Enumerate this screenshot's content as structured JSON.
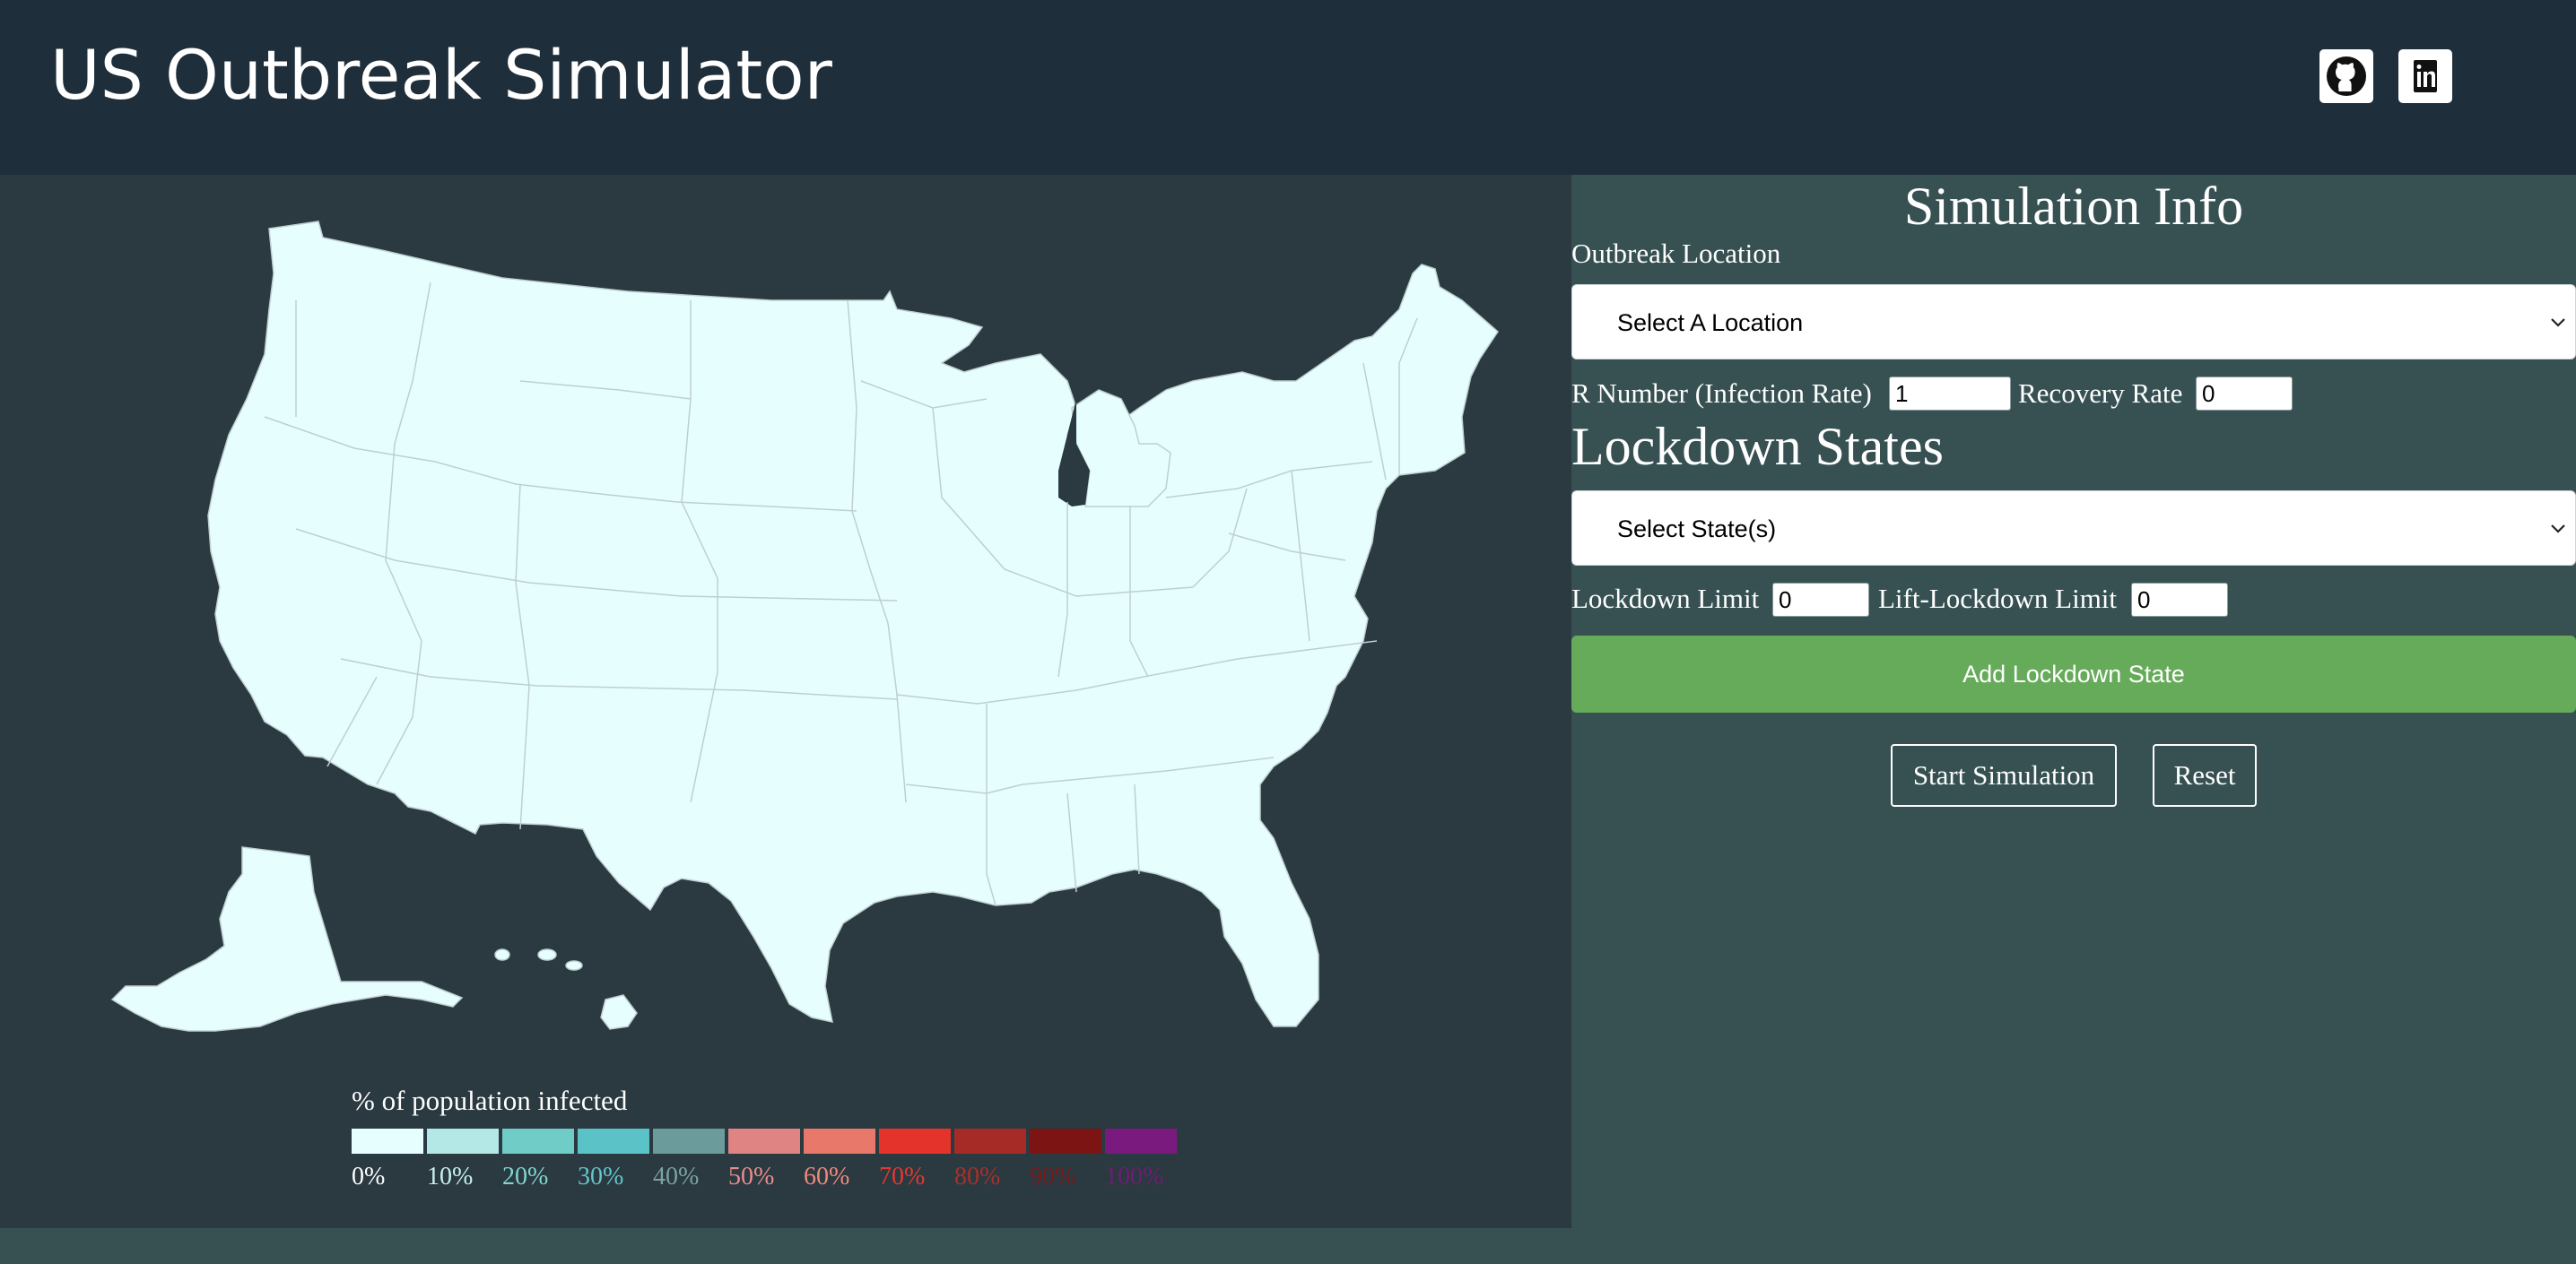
{
  "header": {
    "title": "US Outbreak Simulator",
    "icons": [
      "github-icon",
      "linkedin-icon"
    ]
  },
  "map": {
    "state_fill": "#e6fffe",
    "background": "#2b3941"
  },
  "legend": {
    "title": "% of population infected",
    "items": [
      {
        "label": "0%",
        "color": "#e6fffe",
        "text_color": "#ffffff"
      },
      {
        "label": "10%",
        "color": "#b4e8e6",
        "text_color": "#c8f0ee"
      },
      {
        "label": "20%",
        "color": "#70ccc7",
        "text_color": "#7fd6d0"
      },
      {
        "label": "30%",
        "color": "#5bc3c8",
        "text_color": "#62c6cb"
      },
      {
        "label": "40%",
        "color": "#6b9b9b",
        "text_color": "#7aa3a3"
      },
      {
        "label": "50%",
        "color": "#e08383",
        "text_color": "#e98d8d"
      },
      {
        "label": "60%",
        "color": "#e8786a",
        "text_color": "#ef8a7c"
      },
      {
        "label": "70%",
        "color": "#e3332a",
        "text_color": "#e4382f"
      },
      {
        "label": "80%",
        "color": "#a62b26",
        "text_color": "#a83028"
      },
      {
        "label": "90%",
        "color": "#7c1414",
        "text_color": "#7a1818"
      },
      {
        "label": "100%",
        "color": "#7a1a7e",
        "text_color": "#6f1c74"
      }
    ]
  },
  "info": {
    "title": "Simulation Info",
    "outbreak_label": "Outbreak Location",
    "outbreak_select": "Select A Location",
    "r_number_label": "R Number (Infection Rate)",
    "r_number_value": "1",
    "recovery_label": "Recovery Rate",
    "recovery_value": "0",
    "lockdown_heading": "Lockdown States",
    "lockdown_select": "Select State(s)",
    "lockdown_limit_label": "Lockdown Limit",
    "lockdown_limit_value": "0",
    "lift_limit_label": "Lift-Lockdown Limit",
    "lift_limit_value": "0",
    "add_button": "Add Lockdown State",
    "start_button": "Start Simulation",
    "reset_button": "Reset"
  },
  "colors": {
    "header_bg": "#1e2e3a",
    "panel_bg": "#375152",
    "add_button_bg": "#66ab5a"
  }
}
